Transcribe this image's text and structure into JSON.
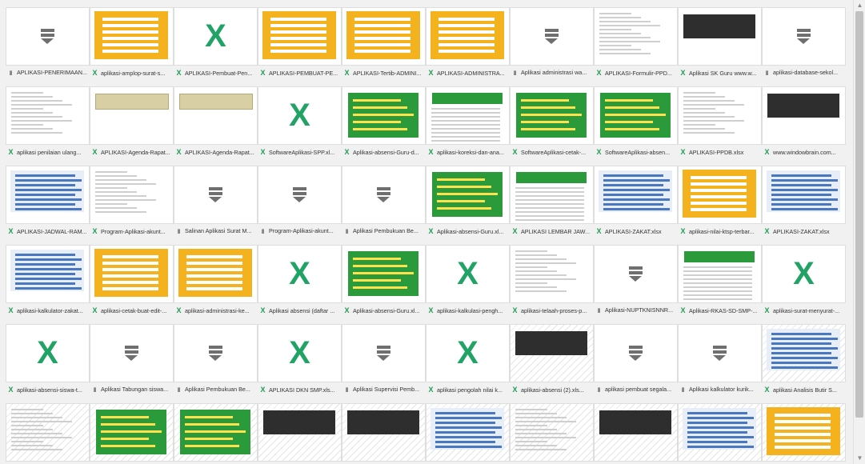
{
  "files": [
    {
      "label": "APLIKASI-PENERIMAAN...",
      "type": "generic",
      "thumb": "generic"
    },
    {
      "label": "aplikasi-amplop-surat-s...",
      "type": "excel",
      "thumb": "yellow"
    },
    {
      "label": "APLIKASI-Pembuat-Pen...",
      "type": "excel",
      "thumb": "x"
    },
    {
      "label": "APLIKASI-PEMBUAT-PE...",
      "type": "excel",
      "thumb": "yellow"
    },
    {
      "label": "APLIKASI-Tertib-ADMINI...",
      "type": "excel",
      "thumb": "yellow"
    },
    {
      "label": "APLIKASI-ADMINISTRA...",
      "type": "excel",
      "thumb": "yellow"
    },
    {
      "label": "Aplikasi administrasi wa...",
      "type": "generic",
      "thumb": "generic"
    },
    {
      "label": "APLIKASI-Formulir-PPD...",
      "type": "excel",
      "thumb": "lines"
    },
    {
      "label": "Aplikasi SK Guru www.w...",
      "type": "excel",
      "thumb": "dark"
    },
    {
      "label": "aplikasi-database-sekol...",
      "type": "generic",
      "thumb": "generic"
    },
    {
      "label": "aplikasi penilaian ulang...",
      "type": "excel",
      "thumb": "lines"
    },
    {
      "label": "APLIKASI-Agenda-Rapat...",
      "type": "excel",
      "thumb": "tan"
    },
    {
      "label": "APLIKASI-Agenda-Rapat...",
      "type": "excel",
      "thumb": "tan"
    },
    {
      "label": "SoftwareAplikasi-SPP.xl...",
      "type": "excel",
      "thumb": "x"
    },
    {
      "label": "Aplikasi-absensi-Guru-d...",
      "type": "excel",
      "thumb": "green"
    },
    {
      "label": "aplikasi-koreksi-dan-ana...",
      "type": "excel",
      "thumb": "greenlines"
    },
    {
      "label": "SoftwareAplikasi-cetak-...",
      "type": "excel",
      "thumb": "green"
    },
    {
      "label": "SoftwareAplikasi-absen...",
      "type": "excel",
      "thumb": "green"
    },
    {
      "label": "APLIKASI-PPDB.xlsx",
      "type": "excel",
      "thumb": "lines"
    },
    {
      "label": "www.windowbrain.com...",
      "type": "excel",
      "thumb": "dark"
    },
    {
      "label": "APLIKASI-JADWAL-RAM...",
      "type": "excel",
      "thumb": "blue"
    },
    {
      "label": "Program-Aplikasi-akunt...",
      "type": "excel",
      "thumb": "lines"
    },
    {
      "label": "Salinan Aplikasi Surat M...",
      "type": "generic",
      "thumb": "generic"
    },
    {
      "label": "Program-Aplikasi-akunt...",
      "type": "generic",
      "thumb": "generic"
    },
    {
      "label": "Aplikasi Pembukuan Be...",
      "type": "generic",
      "thumb": "generic"
    },
    {
      "label": "Aplikasi-absensi-Guru.xl...",
      "type": "excel",
      "thumb": "green"
    },
    {
      "label": "APLIKASI LEMBAR JAW...",
      "type": "excel",
      "thumb": "greenlines"
    },
    {
      "label": "APLIKASI-ZAKAT.xlsx",
      "type": "excel",
      "thumb": "blue"
    },
    {
      "label": "aplikasi-nilai-ktsp-terbar...",
      "type": "excel",
      "thumb": "yellow"
    },
    {
      "label": "APLIKASI-ZAKAT.xlsx",
      "type": "excel",
      "thumb": "blue"
    },
    {
      "label": "aplikasi-kalkulator-zakat...",
      "type": "excel",
      "thumb": "blue"
    },
    {
      "label": "aplikasi-cetak-buat-edit-...",
      "type": "excel",
      "thumb": "yellow"
    },
    {
      "label": "aplikasi-administrasi-ke...",
      "type": "excel",
      "thumb": "yellow"
    },
    {
      "label": "Aplikasi absensi (daftar ...",
      "type": "excel",
      "thumb": "x"
    },
    {
      "label": "Aplikasi-absensi-Guru.xl...",
      "type": "excel",
      "thumb": "green"
    },
    {
      "label": "aplikasi-kalkulasi-pengh...",
      "type": "excel",
      "thumb": "x"
    },
    {
      "label": "aplikasi-telaah-proses-p...",
      "type": "excel",
      "thumb": "lines"
    },
    {
      "label": "Aplikasi-NUPTKNISNNR...",
      "type": "generic",
      "thumb": "generic"
    },
    {
      "label": "Aplikasi-RKAS-SD-SMP-...",
      "type": "excel",
      "thumb": "greenlines"
    },
    {
      "label": "aplikasi-surat-menyurat-...",
      "type": "excel",
      "thumb": "x"
    },
    {
      "label": "aplikasi-absensi-siswa-t...",
      "type": "excel",
      "thumb": "x"
    },
    {
      "label": "Aplikasi Tabungan siswa...",
      "type": "generic",
      "thumb": "generic"
    },
    {
      "label": "Aplikasi Pembukuan Be...",
      "type": "generic",
      "thumb": "generic"
    },
    {
      "label": "APLIKASI DKN SMP.xls...",
      "type": "excel",
      "thumb": "x"
    },
    {
      "label": "Aplikasi Supervisi Pemb...",
      "type": "generic",
      "thumb": "generic"
    },
    {
      "label": "aplikasi pengolah nilai k...",
      "type": "excel",
      "thumb": "x"
    },
    {
      "label": "aplikasi-absensi (2).xls...",
      "type": "excel",
      "thumb": "darkhatch"
    },
    {
      "label": "aplikasi pembuat segala...",
      "type": "generic",
      "thumb": "generic"
    },
    {
      "label": "Aplikasi kalkulator kurik...",
      "type": "generic",
      "thumb": "generic"
    },
    {
      "label": "aplikasi Analisis Butir S...",
      "type": "excel",
      "thumb": "bluehatch"
    },
    {
      "label": "",
      "type": "none",
      "thumb": "lineshatch"
    },
    {
      "label": "",
      "type": "none",
      "thumb": "greenhatch"
    },
    {
      "label": "",
      "type": "none",
      "thumb": "greenhatch"
    },
    {
      "label": "",
      "type": "none",
      "thumb": "darkhatch"
    },
    {
      "label": "",
      "type": "none",
      "thumb": "darkhatch"
    },
    {
      "label": "",
      "type": "none",
      "thumb": "bluehatch"
    },
    {
      "label": "",
      "type": "none",
      "thumb": "lineshatch"
    },
    {
      "label": "",
      "type": "none",
      "thumb": "darkhatch"
    },
    {
      "label": "",
      "type": "none",
      "thumb": "bluehatch"
    },
    {
      "label": "",
      "type": "none",
      "thumb": "yellowhatch"
    }
  ],
  "icons": {
    "excel": "X",
    "generic": "▮"
  },
  "colors": {
    "excel": "#21a366",
    "green_sheet": "#2a9a3a",
    "yellow_sheet": "#f4b21f"
  }
}
